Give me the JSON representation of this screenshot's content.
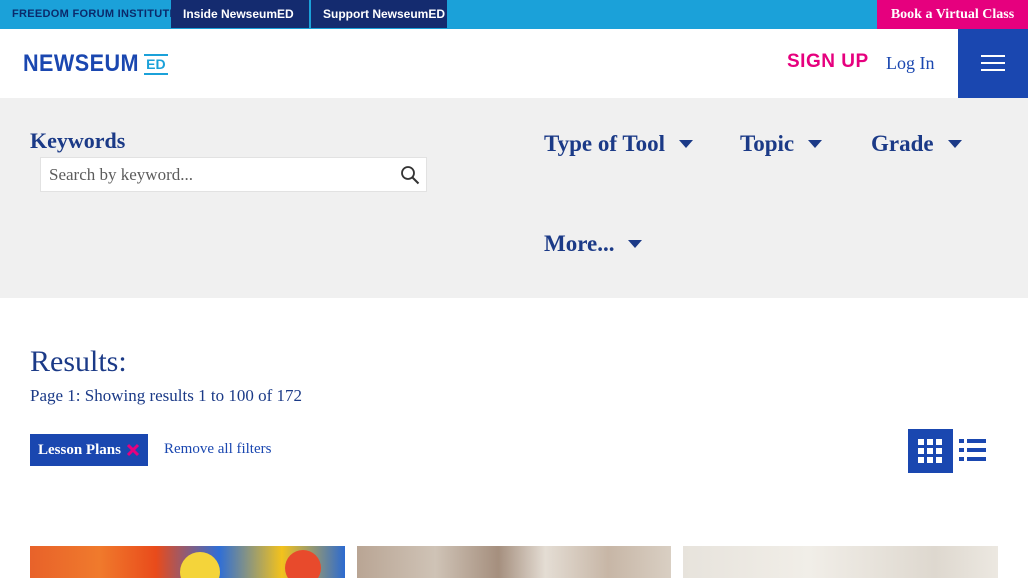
{
  "topbar": {
    "institute": "FREEDOM FORUM INSTITUTE",
    "tab_inside": "Inside NewseumED",
    "tab_support": "Support NewseumED",
    "book_label": "Book a Virtual Class"
  },
  "header": {
    "logo_word": "NEWSEUM",
    "logo_ed": "ED",
    "signup": "SIGN UP",
    "login": "Log In",
    "menu_icon": "hamburger-icon"
  },
  "filters": {
    "keywords_label": "Keywords",
    "search_placeholder": "Search by keyword...",
    "search_icon": "search-icon",
    "dropdowns": [
      "Type of Tool",
      "Topic",
      "Grade",
      "More..."
    ]
  },
  "results": {
    "title": "Results:",
    "summary": "Page 1: Showing results 1 to 100 of 172",
    "active_filter": "Lesson Plans",
    "remove_all": "Remove all filters",
    "view_grid_icon": "grid-view-icon",
    "view_list_icon": "list-view-icon"
  },
  "colors": {
    "accent_blue": "#1a47b0",
    "bar_cyan": "#1ba1d9",
    "navy": "#142b6f",
    "magenta": "#e6007e",
    "filter_bg": "#f0f0f0"
  }
}
